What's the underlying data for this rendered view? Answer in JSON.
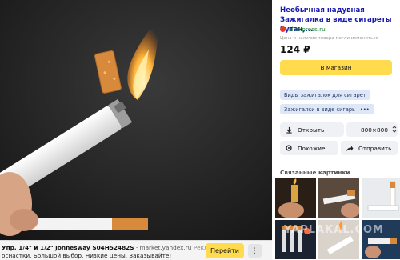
{
  "ad": {
    "title": "Упр. 1/4\" и 1/2\" Jonnesway S04H52482S",
    "separator": "·",
    "domain": "market.yandex.ru",
    "badge": "Реклама",
    "badge_dot": "•",
    "description": "оснастки. Большой выбор. Низкие цены. Заказывайте!",
    "cta_label": "Перейти",
    "more_icon": "⋮"
  },
  "panel": {
    "title": "Необычная надувная Зажигалка в виде сигареты бутан,...",
    "source": "aliexpress.ru",
    "note": "Цена и наличие товара могли измениться",
    "price": "124 ₽",
    "shop_label": "В магазин",
    "tags": [
      "Виды зажигалок для сигарет",
      "Зажигалки в виде сигары"
    ],
    "tags_more": "•••",
    "open_label": "Открыть",
    "size_label": "800×800",
    "similar_label": "Похожие",
    "share_label": "Отправить",
    "related_title": "Связанные картинки"
  },
  "watermark": "YAPLAKAL.COM",
  "colors": {
    "accent_yellow": "#ffdb4d",
    "link_blue": "#1a1ab0",
    "source_green": "#1a7f37",
    "tag_bg": "#dde7f7"
  }
}
